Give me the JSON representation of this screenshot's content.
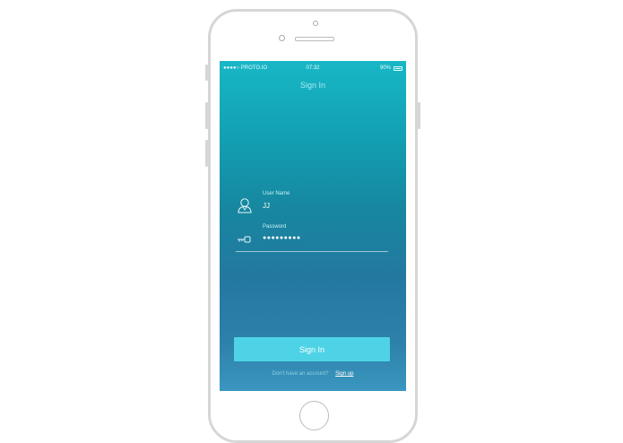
{
  "device": {
    "model": "iphone",
    "body_color": "#d6d6d6"
  },
  "status_bar": {
    "carrier": "●●●●○ PROTO.IO",
    "time": "07:32",
    "battery": "90%"
  },
  "screen": {
    "title": "Sign In",
    "username": {
      "label": "User Name",
      "value": "JJ",
      "icon": "user-icon"
    },
    "password": {
      "label": "Password",
      "value": "●●●●●●●●●",
      "icon": "key-icon"
    },
    "sign_in_button": "Sign In",
    "footer": {
      "prompt": "Don't have an account?",
      "link": "Sign up"
    }
  },
  "colors": {
    "accent": "#4dd3e5",
    "gradient_top": "#18b7c6",
    "gradient_bottom": "#3a97bf"
  }
}
